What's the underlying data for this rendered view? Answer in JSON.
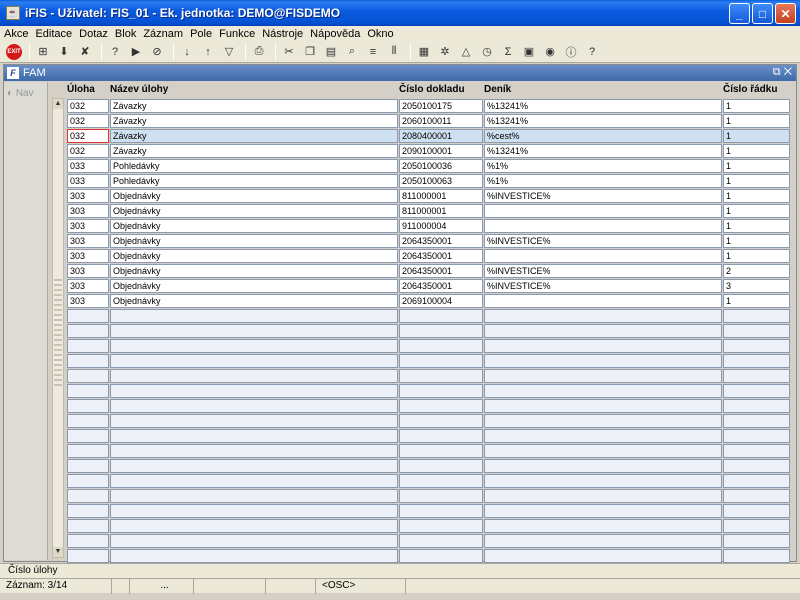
{
  "window": {
    "title": "iFIS - Uživatel: FIS_01 - Ek. jednotka: DEMO@FISDEMO"
  },
  "menu": [
    "Akce",
    "Editace",
    "Dotaz",
    "Blok",
    "Záznam",
    "Pole",
    "Funkce",
    "Nástroje",
    "Nápověda",
    "Okno"
  ],
  "toolbar": {
    "exit_label": "EXIT"
  },
  "inner_window": {
    "title": "FAM",
    "nav_label": "Nav"
  },
  "columns": [
    "Úloha",
    "Název úlohy",
    "Číslo dokladu",
    "Deník",
    "Číslo řádku"
  ],
  "rows": [
    [
      "032",
      "Závazky",
      "2050100175",
      "%13241%",
      "1"
    ],
    [
      "032",
      "Závazky",
      "2060100011",
      "%13241%",
      "1"
    ],
    [
      "032",
      "Závazky",
      "2080400001",
      "%cest%",
      "1"
    ],
    [
      "032",
      "Závazky",
      "2090100001",
      "%13241%",
      "1"
    ],
    [
      "033",
      "Pohledávky",
      "2050100036",
      "%1%",
      "1"
    ],
    [
      "033",
      "Pohledávky",
      "2050100063",
      "%1%",
      "1"
    ],
    [
      "303",
      "Objednávky",
      "811000001",
      "%INVESTICE%",
      "1"
    ],
    [
      "303",
      "Objednávky",
      "811000001",
      "",
      "1"
    ],
    [
      "303",
      "Objednávky",
      "911000004",
      "",
      "1"
    ],
    [
      "303",
      "Objednávky",
      "2064350001",
      "%INVESTICE%",
      "1"
    ],
    [
      "303",
      "Objednávky",
      "2064350001",
      "",
      "1"
    ],
    [
      "303",
      "Objednávky",
      "2064350001",
      "%INVESTICE%",
      "2"
    ],
    [
      "303",
      "Objednávky",
      "2064350001",
      "%INVESTICE%",
      "3"
    ],
    [
      "303",
      "Objednávky",
      "2069100004",
      "",
      "1"
    ]
  ],
  "selected_row_index": 2,
  "empty_row_count": 17,
  "status": {
    "field_hint": "Číslo úlohy",
    "record": "Záznam: 3/14",
    "ellipsis": "...",
    "osc": "<OSC>"
  }
}
